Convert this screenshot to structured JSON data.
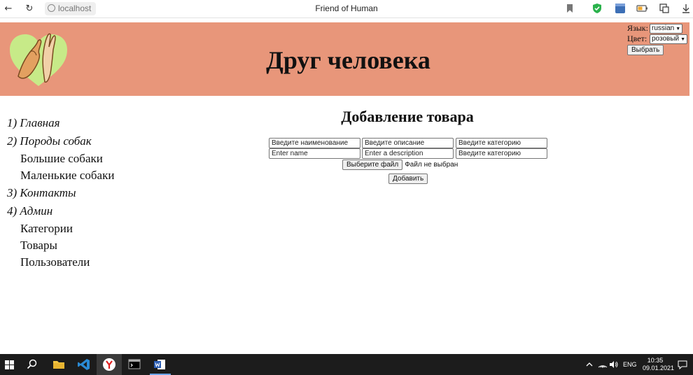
{
  "browser": {
    "address": "localhost",
    "tab_title": "Friend of Human",
    "back_icon": "arrow-left-icon",
    "reload_icon": "reload-icon"
  },
  "header": {
    "title": "Друг человека",
    "language_label": "Язык:",
    "language_value": "russian",
    "color_label": "Цвет:",
    "color_value": "розовый",
    "select_button": "Выбрать",
    "bg_color": "#e8967a"
  },
  "sidebar": {
    "items": [
      {
        "label": "1) Главная"
      },
      {
        "label": "2) Породы собак"
      },
      {
        "label": "Большие собаки"
      },
      {
        "label": "Маленькие собаки"
      },
      {
        "label": "3) Контакты"
      },
      {
        "label": "4) Админ"
      },
      {
        "label": "Категории"
      },
      {
        "label": "Товары"
      },
      {
        "label": "Пользователи"
      }
    ]
  },
  "form": {
    "title": "Добавление товара",
    "name_ru_placeholder": "Введите наименование",
    "desc_ru_placeholder": "Введите описание",
    "category_1_placeholder": "Введите категорию",
    "name_en_placeholder": "Enter name",
    "desc_en_placeholder": "Enter a description",
    "category_2_placeholder": "Введите категорию",
    "file_button": "Выберите файл",
    "file_status": "Файл не выбран",
    "submit_button": "Добавить"
  },
  "taskbar": {
    "language": "ENG",
    "time": "10:35",
    "date": "09.01.2021"
  }
}
